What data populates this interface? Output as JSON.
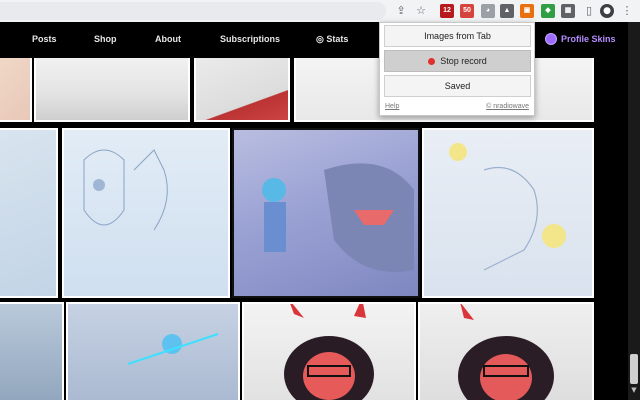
{
  "browser": {
    "extensions": [
      "share-icon",
      "star-icon",
      "ext-red-icon",
      "ext-tab-icon",
      "ext-cat-icon",
      "ext-ghost-icon",
      "ext-orange-icon",
      "ext-green-icon",
      "ext-grid-icon",
      "puzzle-icon",
      "sidepanel-icon",
      "profile-icon",
      "menu-icon"
    ],
    "ext_badges": {
      "red": "12",
      "tab": "50"
    }
  },
  "site_nav": {
    "items": [
      "Posts",
      "Shop",
      "About",
      "Subscriptions",
      "Stats"
    ],
    "profile_skins": "Profile Skins"
  },
  "popup": {
    "images_from_tab": "Images from Tab",
    "stop_record": "Stop record",
    "saved": "Saved",
    "help": "Help",
    "credit": "© nradiowave"
  },
  "colors": {
    "record_red": "#e0302d",
    "skins_purple": "#b58cff"
  }
}
